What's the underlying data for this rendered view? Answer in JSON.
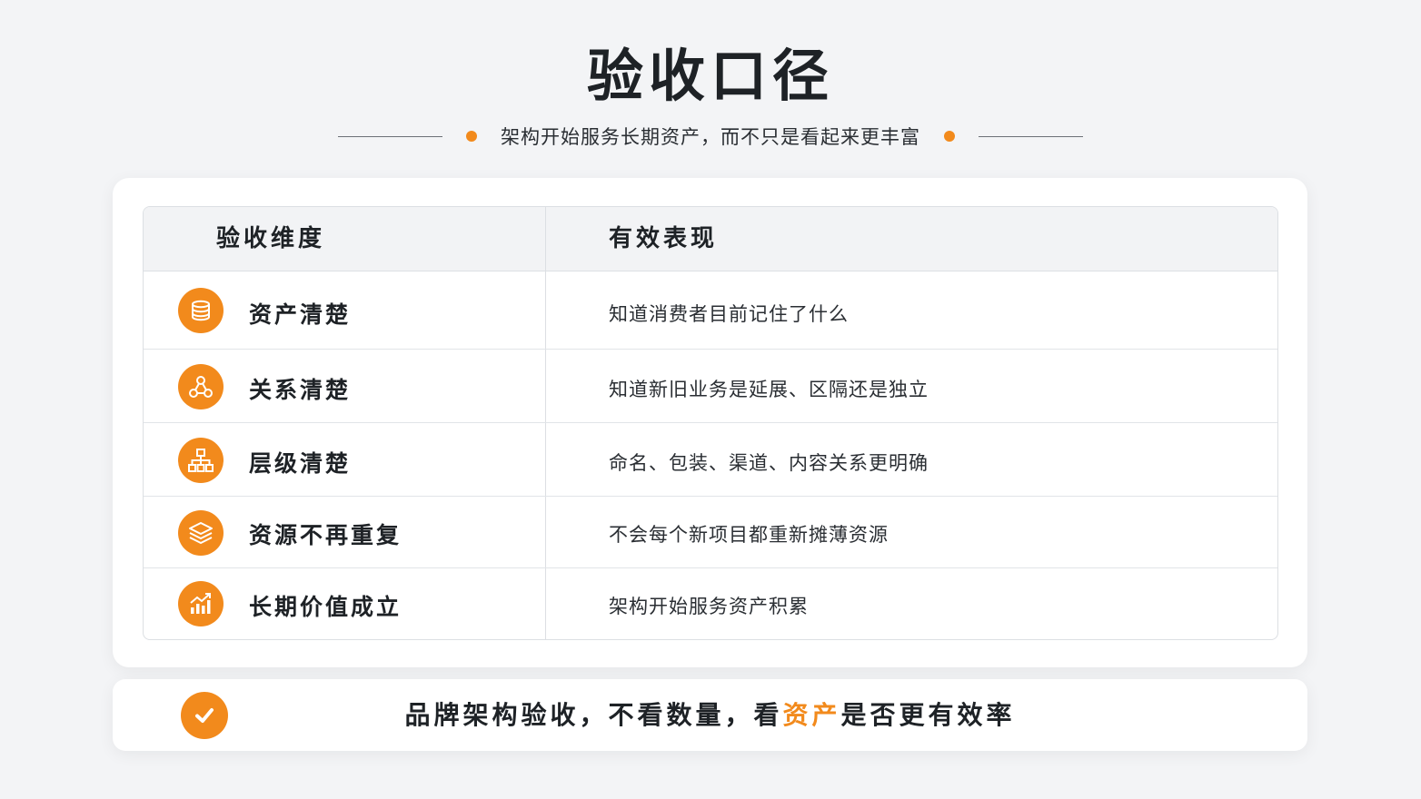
{
  "page": {
    "title": "验收口径",
    "subtitle": "架构开始服务长期资产，而不只是看起来更丰富"
  },
  "table": {
    "headers": [
      "验收维度",
      "有效表现"
    ],
    "rows": [
      {
        "icon": "database-icon",
        "dimension": "资产清楚",
        "value": "知道消费者目前记住了什么"
      },
      {
        "icon": "relationship-nodes-icon",
        "dimension": "关系清楚",
        "value": "知道新旧业务是延展、区隔还是独立"
      },
      {
        "icon": "hierarchy-icon",
        "dimension": "层级清楚",
        "value": "命名、包装、渠道、内容关系更明确"
      },
      {
        "icon": "layers-icon",
        "dimension": "资源不再重复",
        "value": "不会每个新项目都重新摊薄资源"
      },
      {
        "icon": "growth-chart-icon",
        "dimension": "长期价值成立",
        "value": "架构开始服务资产积累"
      }
    ]
  },
  "footer": {
    "icon": "check-icon",
    "text_before": "品牌架构验收，不看数量，看",
    "text_highlight": "资产",
    "text_after": "是否更有效率"
  },
  "colors": {
    "accent": "#f28a1c",
    "text": "#1e2226",
    "background": "#f3f4f6"
  }
}
